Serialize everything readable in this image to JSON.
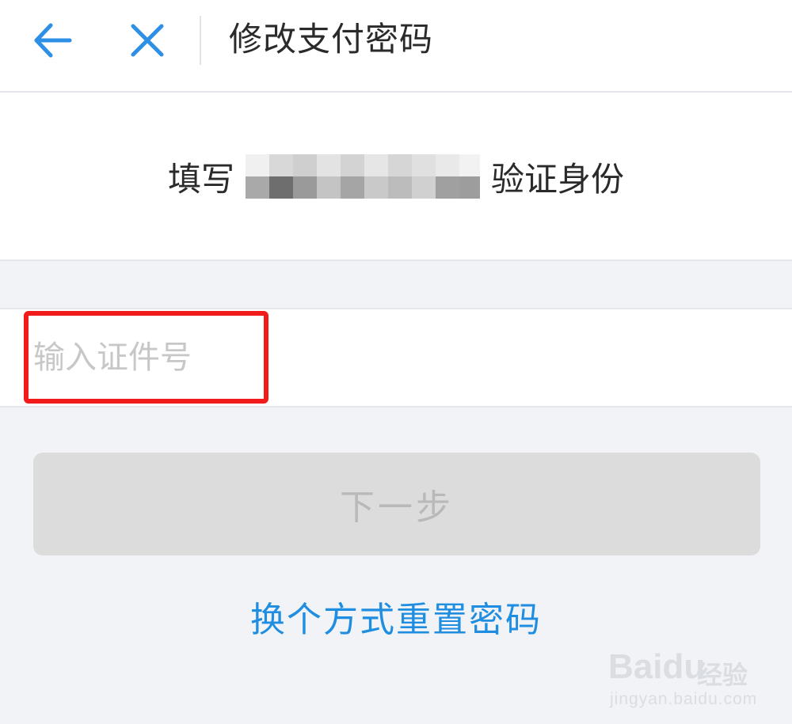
{
  "header": {
    "back_icon": "arrow-left-icon",
    "close_icon": "close-icon",
    "title": "修改支付密码"
  },
  "instruction": {
    "prefix": "填写",
    "suffix": "验证身份"
  },
  "id_input": {
    "placeholder": "输入证件号",
    "value": ""
  },
  "next_button": {
    "label": "下一步"
  },
  "alt_link": {
    "label": "换个方式重置密码"
  },
  "watermark": {
    "brand": "Baidu",
    "cn": "经验",
    "url": "jingyan.baidu.com"
  },
  "colors": {
    "accent_blue": "#1f8ee0",
    "highlight_red": "#f21b1b",
    "background": "#f1f3f6",
    "disabled_button": "#dcdcdc"
  }
}
